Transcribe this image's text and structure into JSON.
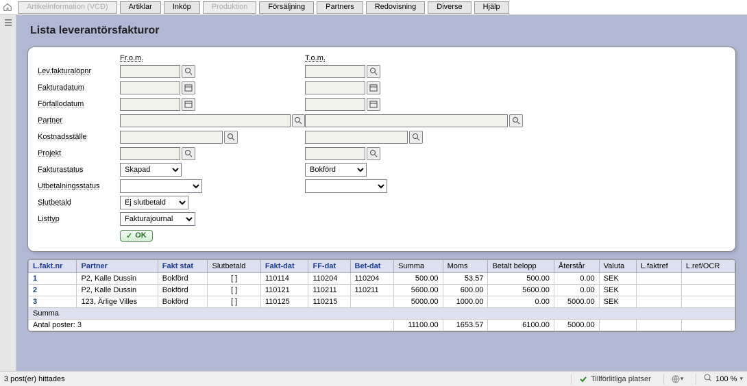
{
  "nav": {
    "tabs": [
      {
        "label": "Artikelinformation (VCD)",
        "disabled": true
      },
      {
        "label": "Artiklar"
      },
      {
        "label": "Inköp"
      },
      {
        "label": "Produktion",
        "disabled": true
      },
      {
        "label": "Försäljning"
      },
      {
        "label": "Partners"
      },
      {
        "label": "Redovisning"
      },
      {
        "label": "Diverse"
      },
      {
        "label": "Hjälp"
      }
    ]
  },
  "page": {
    "title": "Lista leverantörsfakturor"
  },
  "filters": {
    "from_header": "Fr.o.m.",
    "to_header": "T.o.m.",
    "labels": {
      "levfakturanr": "Lev.fakturalöpnr",
      "fakturadatum": "Fakturadatum",
      "forfallodatum": "Förfallodatum",
      "partner": "Partner",
      "kostnadsstalle": "Kostnadsställe",
      "projekt": "Projekt",
      "fakturastatus": "Fakturastatus",
      "utbetalningsstatus": "Utbetalningsstatus",
      "slutbetald": "Slutbetald",
      "listtyp": "Listtyp"
    },
    "values": {
      "fakturastatus_from": "Skapad",
      "fakturastatus_to": "Bokförd",
      "utbetalningsstatus_from": "",
      "utbetalningsstatus_to": "",
      "slutbetald": "Ej slutbetald",
      "listtyp": "Fakturajournal"
    },
    "ok_label": "OK"
  },
  "table": {
    "headers": {
      "lfaktnr": "L.fakt.nr",
      "partner": "Partner",
      "faktstat": "Fakt stat",
      "slutbetald": "Slutbetald",
      "faktdat": "Fakt-dat",
      "ffdat": "FF-dat",
      "betdat": "Bet-dat",
      "summa": "Summa",
      "moms": "Moms",
      "betalt": "Betalt belopp",
      "aterstar": "Återstår",
      "valuta": "Valuta",
      "lfaktref": "L.faktref",
      "lrefocr": "L.ref/OCR"
    },
    "rows": [
      {
        "nr": "1",
        "partner": "P2, Kalle Dussin",
        "stat": "Bokförd",
        "slut": "[  ]",
        "fd": "110114",
        "ff": "110204",
        "bd": "110204",
        "summa": "500.00",
        "moms": "53.57",
        "betalt": "500.00",
        "aterstar": "0.00",
        "valuta": "SEK",
        "ref": "",
        "ocr": ""
      },
      {
        "nr": "2",
        "partner": "P2, Kalle Dussin",
        "stat": "Bokförd",
        "slut": "[  ]",
        "fd": "110121",
        "ff": "110211",
        "bd": "110211",
        "summa": "5600.00",
        "moms": "600.00",
        "betalt": "5600.00",
        "aterstar": "0.00",
        "valuta": "SEK",
        "ref": "",
        "ocr": ""
      },
      {
        "nr": "3",
        "partner": "123, Ärlige Villes",
        "stat": "Bokförd",
        "slut": "[  ]",
        "fd": "110125",
        "ff": "110215",
        "bd": "",
        "summa": "5000.00",
        "moms": "1000.00",
        "betalt": "0.00",
        "aterstar": "5000.00",
        "valuta": "SEK",
        "ref": "",
        "ocr": ""
      }
    ],
    "summa_label": "Summa",
    "antal_label": "Antal poster: 3",
    "totals": {
      "summa": "11100.00",
      "moms": "1653.57",
      "betalt": "6100.00",
      "aterstar": "5000.00"
    }
  },
  "statusbar": {
    "left": "3 post(er) hittades",
    "trust": "Tillförlitliga platser",
    "zoom": "100 %"
  }
}
